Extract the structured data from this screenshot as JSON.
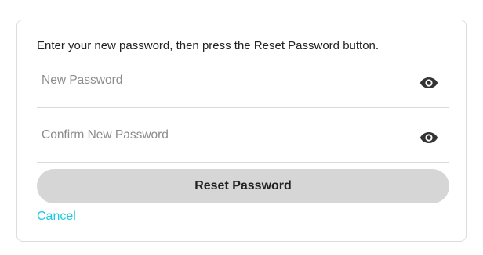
{
  "form": {
    "instructions": "Enter your new password, then press the Reset Password button.",
    "new_password": {
      "value": "",
      "placeholder": "New Password",
      "icon": "eye-icon"
    },
    "confirm_password": {
      "value": "",
      "placeholder": "Confirm New Password",
      "icon": "eye-icon"
    },
    "reset_button_label": "Reset Password",
    "cancel_label": "Cancel"
  },
  "colors": {
    "button_background": "#d6d6d6",
    "link": "#1ecbe1",
    "border": "#dcdcdc",
    "text": "#222222",
    "placeholder": "#8c8c8c"
  }
}
